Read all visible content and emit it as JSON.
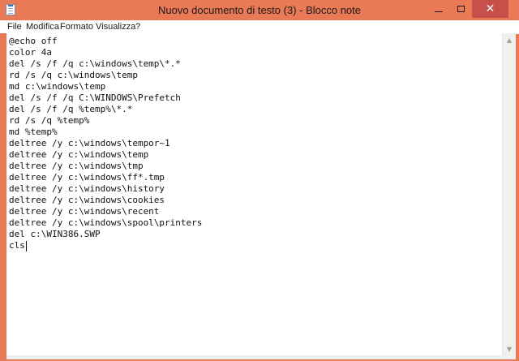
{
  "window": {
    "title": "Nuovo documento di testo (3) - Blocco note",
    "icon": "notepad-icon",
    "frame_color": "#e97a55",
    "close_color": "#c7504a"
  },
  "menu": [
    {
      "label": "File"
    },
    {
      "label": "Modifica"
    },
    {
      "label": "Formato"
    },
    {
      "label": "Visualizza"
    },
    {
      "label": "?"
    }
  ],
  "editor": {
    "lines": [
      "@echo off",
      "color 4a",
      "del /s /f /q c:\\windows\\temp\\*.*",
      "rd /s /q c:\\windows\\temp",
      "md c:\\windows\\temp",
      "del /s /f /q C:\\WINDOWS\\Prefetch",
      "del /s /f /q %temp%\\*.*",
      "rd /s /q %temp%",
      "md %temp%",
      "deltree /y c:\\windows\\tempor~1",
      "deltree /y c:\\windows\\temp",
      "deltree /y c:\\windows\\tmp",
      "deltree /y c:\\windows\\ff*.tmp",
      "deltree /y c:\\windows\\history",
      "deltree /y c:\\windows\\cookies",
      "deltree /y c:\\windows\\recent",
      "deltree /y c:\\windows\\spool\\printers",
      "del c:\\WIN386.SWP",
      "cls"
    ]
  }
}
